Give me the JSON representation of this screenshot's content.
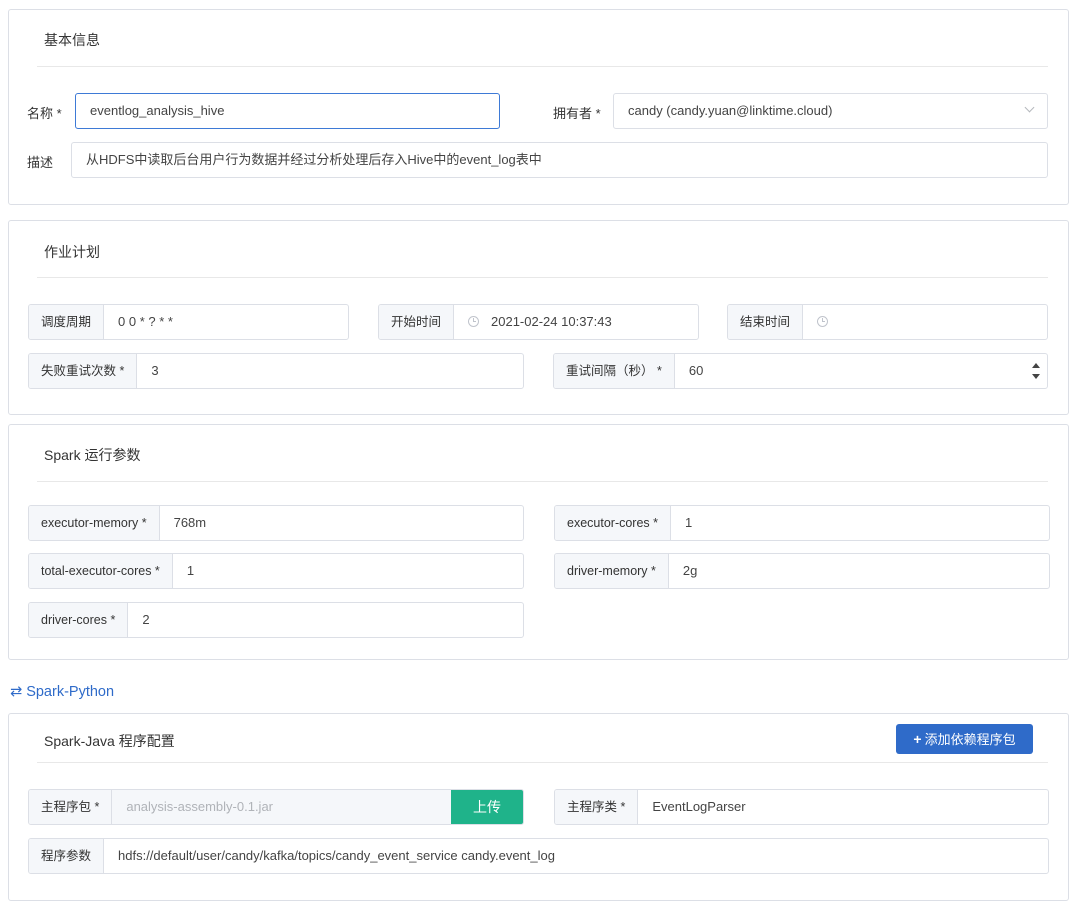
{
  "basic": {
    "title": "基本信息",
    "name_label": "名称 *",
    "name_value": "eventlog_analysis_hive",
    "owner_label": "拥有者 *",
    "owner_value": "candy (candy.yuan@linktime.cloud)",
    "desc_label": "描述",
    "desc_value": "从HDFS中读取后台用户行为数据并经过分析处理后存入Hive中的event_log表中"
  },
  "schedule": {
    "title": "作业计划",
    "cycle_label": "调度周期",
    "cycle_value": "0 0 * ? * *",
    "start_label": "开始时间",
    "start_value": "2021-02-24 10:37:43",
    "end_label": "结束时间",
    "end_value": "",
    "retry_count_label": "失败重试次数 *",
    "retry_count_value": "3",
    "retry_interval_label": "重试间隔（秒） *",
    "retry_interval_value": "60"
  },
  "spark": {
    "title": "Spark 运行参数",
    "executor_memory_label": "executor-memory *",
    "executor_memory_value": "768m",
    "executor_cores_label": "executor-cores *",
    "executor_cores_value": "1",
    "total_executor_cores_label": "total-executor-cores *",
    "total_executor_cores_value": "1",
    "driver_memory_label": "driver-memory *",
    "driver_memory_value": "2g",
    "driver_cores_label": "driver-cores *",
    "driver_cores_value": "2"
  },
  "switch_link": "Spark-Python",
  "program": {
    "title": "Spark-Java 程序配置",
    "add_button": "添加依赖程序包",
    "main_pkg_label": "主程序包 *",
    "main_pkg_value": "analysis-assembly-0.1.jar",
    "upload_button": "上传",
    "main_class_label": "主程序类 *",
    "main_class_value": "EventLogParser",
    "args_label": "程序参数",
    "args_value": "hdfs://default/user/candy/kafka/topics/candy_event_service candy.event_log"
  },
  "colors": {
    "primary": "#2f6bc9",
    "upload": "#1fb38a",
    "border": "#dcdfe6",
    "addon_bg": "#f5f7fa"
  }
}
